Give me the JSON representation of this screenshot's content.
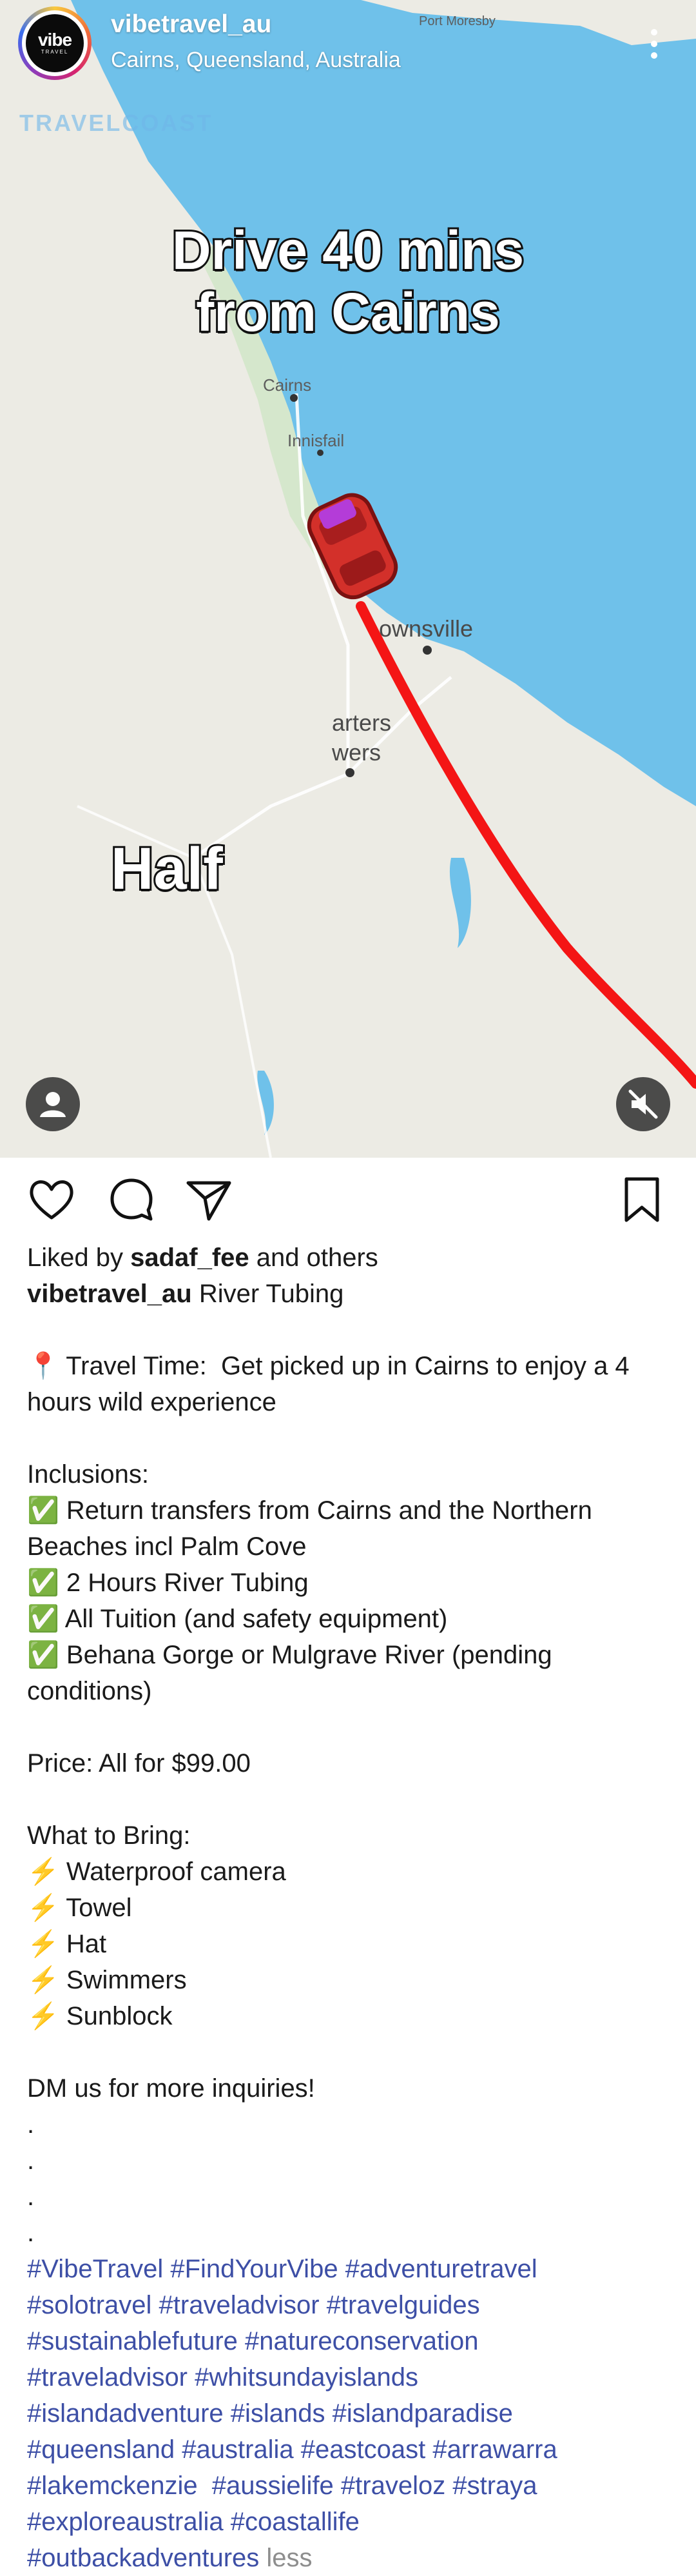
{
  "header": {
    "username": "vibetravel_au",
    "location": "Cairns, Queensland, Australia",
    "avatar_brand": "vibe",
    "avatar_sub": "TRAVEL",
    "watermark": "TRAVELCOAST"
  },
  "media": {
    "overlay_line1": "Drive 40 mins",
    "overlay_line2": "from Cairns",
    "overlay_half": "Half",
    "map_labels": {
      "port_moresby": "Port Moresby",
      "cairns": "Cairns",
      "innisfail": "Innisfail",
      "townsville": "ownsville",
      "charters1": "arters",
      "charters2": "wers"
    },
    "colors": {
      "sea": "#6fc1ea",
      "land": "#ecebe4",
      "route": "#f41515"
    }
  },
  "actions": {
    "like": "heart-icon",
    "comment": "comment-icon",
    "share": "send-icon",
    "save": "bookmark-icon"
  },
  "post": {
    "liked_prefix": "Liked by ",
    "liked_user": "sadaf_fee",
    "liked_suffix": " and others",
    "caption_user": "vibetravel_au",
    "caption_title": " River Tubing",
    "travel_time_1": "📍 Travel Time:  Get picked up in Cairns to enjoy a 4",
    "travel_time_2": "hours wild experience",
    "inclusions_header": "Inclusions:",
    "inclusions": [
      "✅ Return transfers from Cairns and the Northern",
      "Beaches incl Palm Cove",
      "✅ 2 Hours River Tubing",
      "✅ All Tuition (and safety equipment)",
      "✅ Behana Gorge or Mulgrave River (pending",
      "conditions)"
    ],
    "price": "Price: All for $99.00",
    "bring_header": "What to Bring:",
    "bring": [
      "⚡ Waterproof camera",
      "⚡ Towel",
      "⚡ Hat",
      "⚡ Swimmers",
      "⚡ Sunblock"
    ],
    "dm": "DM us for more inquiries!",
    "dots": [
      ".",
      ".",
      ".",
      "."
    ],
    "hashtags": [
      "#VibeTravel #FindYourVibe #adventuretravel",
      "#solotravel #traveladvisor #travelguides",
      "#sustainablefuture #natureconservation",
      "#traveladvisor #whitsundayislands",
      "#islandadventure #islands #islandparadise",
      "#queensland #australia #eastcoast #arrawarra",
      "#lakemckenzie  #aussielife #traveloz #straya",
      "#exploreaustralia #coastallife"
    ],
    "last_hashtag": "#outbackadventures",
    "less": " less"
  }
}
